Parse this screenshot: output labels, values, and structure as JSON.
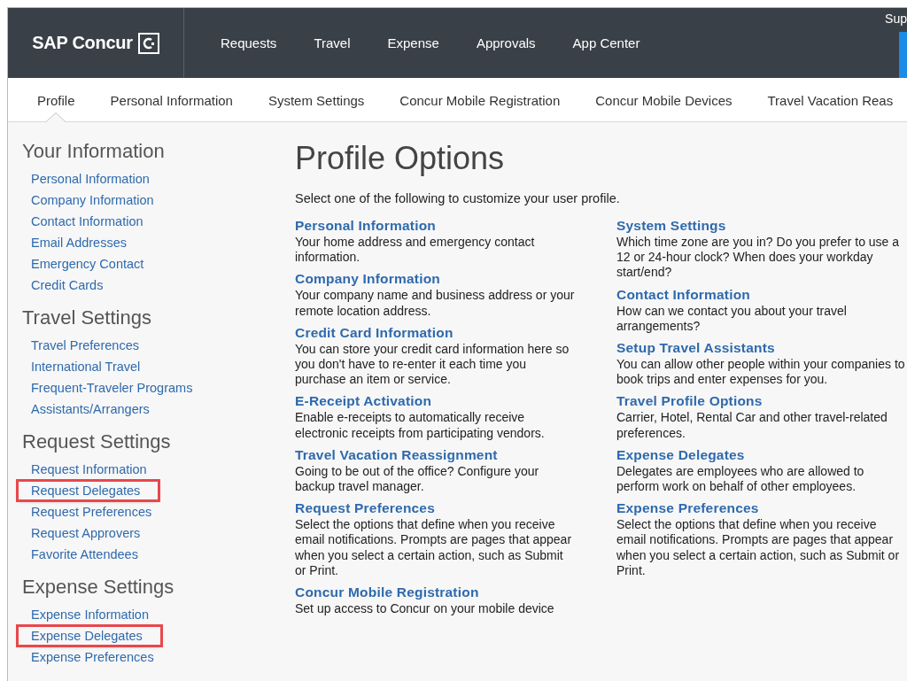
{
  "header": {
    "logo": "SAP Concur",
    "nav": [
      {
        "label": "Requests",
        "selected": false
      },
      {
        "label": "Travel",
        "selected": false
      },
      {
        "label": "Expense",
        "selected": false
      },
      {
        "label": "Approvals",
        "selected": false
      },
      {
        "label": "App Center",
        "selected": false
      }
    ],
    "user_link": "Sup"
  },
  "subnav": [
    {
      "label": "Profile",
      "selected": true
    },
    {
      "label": "Personal Information",
      "selected": false
    },
    {
      "label": "System Settings",
      "selected": false
    },
    {
      "label": "Concur Mobile Registration",
      "selected": false
    },
    {
      "label": "Concur Mobile Devices",
      "selected": false
    },
    {
      "label": "Travel Vacation Reas",
      "selected": false
    }
  ],
  "sidebar": [
    {
      "heading": "Your Information",
      "items": [
        {
          "label": "Personal Information",
          "highlighted": false
        },
        {
          "label": "Company Information",
          "highlighted": false
        },
        {
          "label": "Contact Information",
          "highlighted": false
        },
        {
          "label": "Email Addresses",
          "highlighted": false
        },
        {
          "label": "Emergency Contact",
          "highlighted": false
        },
        {
          "label": "Credit Cards",
          "highlighted": false
        }
      ]
    },
    {
      "heading": "Travel Settings",
      "items": [
        {
          "label": "Travel Preferences",
          "highlighted": false
        },
        {
          "label": "International Travel",
          "highlighted": false
        },
        {
          "label": "Frequent-Traveler Programs",
          "highlighted": false
        },
        {
          "label": "Assistants/Arrangers",
          "highlighted": false
        }
      ]
    },
    {
      "heading": "Request Settings",
      "items": [
        {
          "label": "Request Information",
          "highlighted": false
        },
        {
          "label": "Request Delegates",
          "highlighted": true
        },
        {
          "label": "Request Preferences",
          "highlighted": false
        },
        {
          "label": "Request Approvers",
          "highlighted": false
        },
        {
          "label": "Favorite Attendees",
          "highlighted": false
        }
      ]
    },
    {
      "heading": "Expense Settings",
      "items": [
        {
          "label": "Expense Information",
          "highlighted": false
        },
        {
          "label": "Expense Delegates",
          "highlighted": true
        },
        {
          "label": "Expense Preferences",
          "highlighted": false
        }
      ]
    }
  ],
  "main": {
    "title": "Profile Options",
    "intro": "Select one of the following to customize your user profile.",
    "columns": [
      [
        {
          "title": "Personal Information",
          "description": "Your home address and emergency contact information."
        },
        {
          "title": "Company Information",
          "description": "Your company name and business address or your remote location address."
        },
        {
          "title": "Credit Card Information",
          "description": "You can store your credit card information here so you don't have to re-enter it each time you purchase an item or service."
        },
        {
          "title": "E-Receipt Activation",
          "description": "Enable e-receipts to automatically receive electronic receipts from participating vendors."
        },
        {
          "title": "Travel Vacation Reassignment",
          "description": "Going to be out of the office? Configure your backup travel manager."
        },
        {
          "title": "Request Preferences",
          "description": "Select the options that define when you receive email notifications. Prompts are pages that appear when you select a certain action, such as Submit or Print."
        },
        {
          "title": "Concur Mobile Registration",
          "description": "Set up access to Concur on your mobile device"
        }
      ],
      [
        {
          "title": "System Settings",
          "description": "Which time zone are you in? Do you prefer to use a 12 or 24-hour clock? When does your workday start/end?"
        },
        {
          "title": "Contact Information",
          "description": "How can we contact you about your travel arrangements?"
        },
        {
          "title": "Setup Travel Assistants",
          "description": "You can allow other people within your companies to book trips and enter expenses for you."
        },
        {
          "title": "Travel Profile Options",
          "description": "Carrier, Hotel, Rental Car and other travel-related preferences."
        },
        {
          "title": "Expense Delegates",
          "description": "Delegates are employees who are allowed to perform work on behalf of other employees."
        },
        {
          "title": "Expense Preferences",
          "description": "Select the options that define when you receive email notifications. Prompts are pages that appear when you select a certain action, such as Submit or Print."
        }
      ]
    ]
  }
}
